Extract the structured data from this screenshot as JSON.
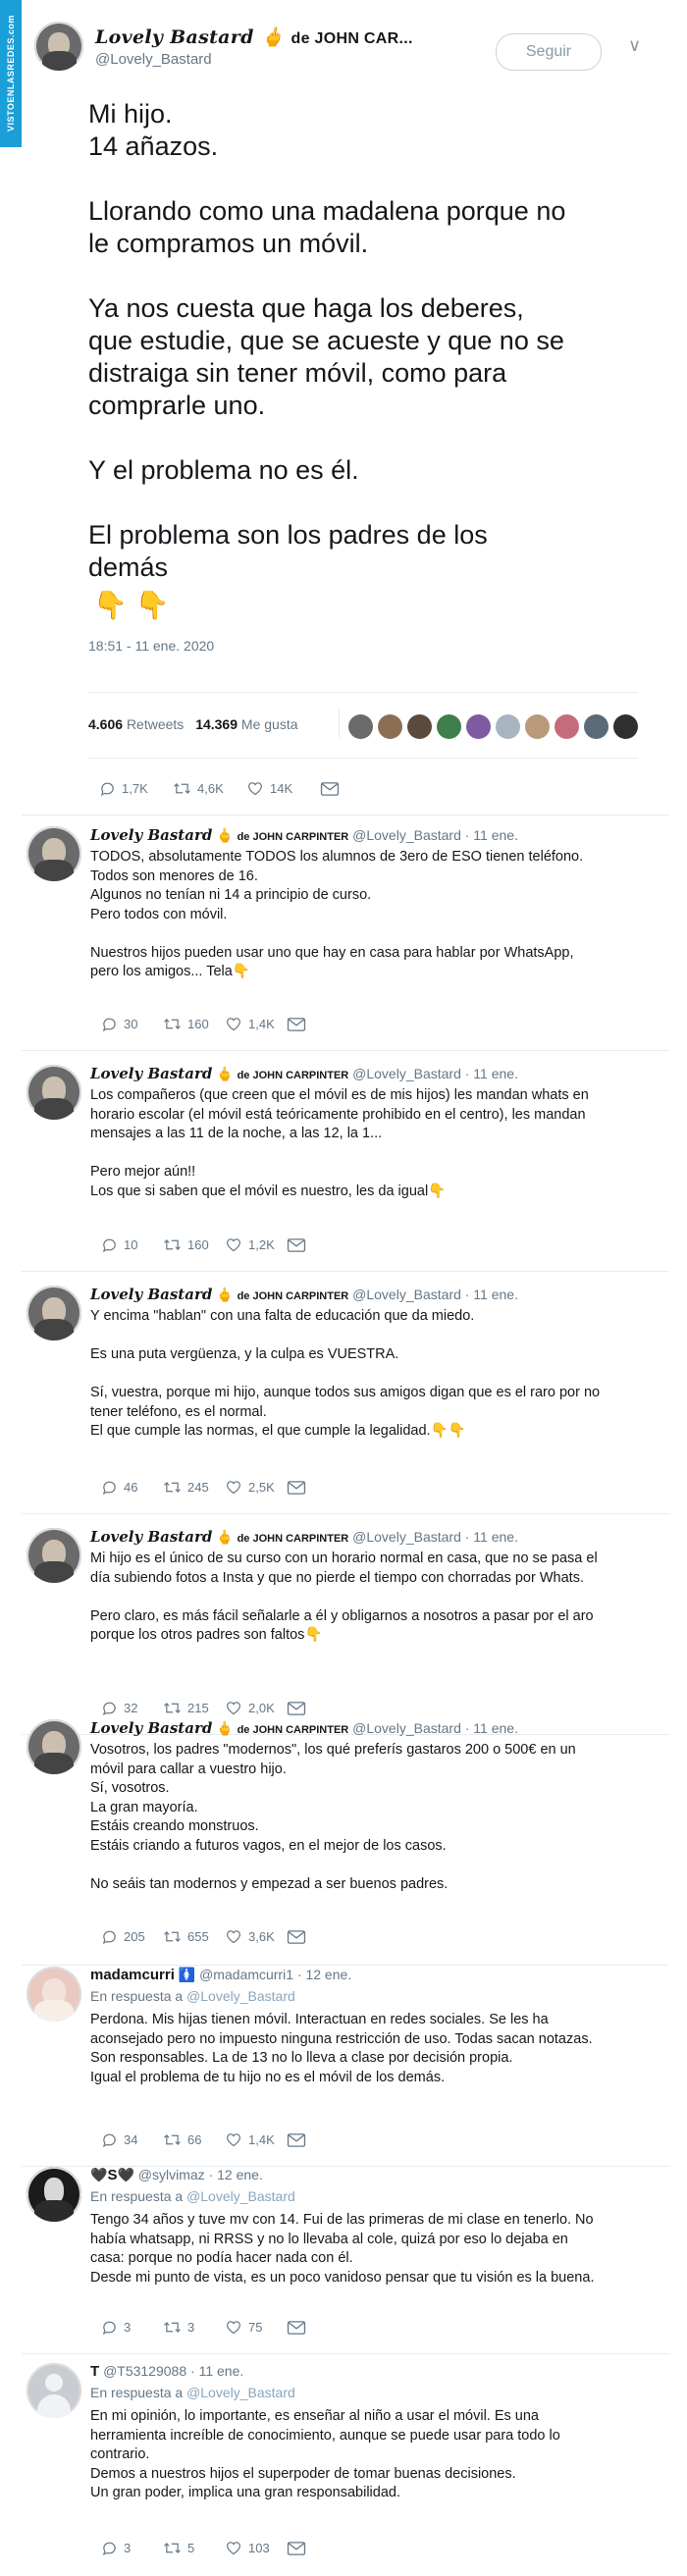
{
  "banner": "VISTOENLASREDES.com",
  "header": {
    "name": "Lovely Bastard",
    "name_rest": "de JOHN CAR...",
    "handle": "@Lovely_Bastard",
    "follow_label": "Seguir",
    "chevron": "∨"
  },
  "tweet": {
    "text": "Mi hijo.\n14 añazos.\n\nLlorando como una madalena porque no\nle compramos un móvil.\n\nYa nos cuesta que haga los deberes,\nque estudie, que se acueste y que no se\ndistraiga sin tener móvil, como para\ncomprarle uno.\n\nY el problema no es él.\n\nEl problema son los padres de los\ndemás",
    "emoji": "👇",
    "time": "18:51 - 11 ene. 2020",
    "retweets": "4.606",
    "retweets_label": "Retweets",
    "likes": "14.369",
    "likes_label": "Me gusta",
    "mini_avatar_colors": [
      "#6b6b6b",
      "#8a6f55",
      "#5c4a3c",
      "#3f7f4b",
      "#7e5aa2",
      "#a8b4c2",
      "#b89a7a",
      "#c56b7b",
      "#5b6a78",
      "#2f2f2f"
    ],
    "actions": {
      "replies": "1,7K",
      "retweets": "4,6K",
      "likes": "14K"
    }
  },
  "replies": [
    {
      "name": "Lovely Bastard",
      "name2": "de JOHN CARPINTER",
      "handle": "@Lovely_Bastard",
      "date": "· 11 ene.",
      "text": "TODOS, absolutamente TODOS los alumnos de 3ero de ESO tienen teléfono.\nTodos son menores de 16.\nAlgunos no tenían ni 14 a principio de curso.\nPero todos con móvil.\n\nNuestros hijos pueden usar uno que hay en casa para hablar por WhatsApp,\npero los amigos... Tela",
      "emoji": "👇",
      "replies": "30",
      "retweets": "160",
      "likes": "1,4K"
    },
    {
      "name": "Lovely Bastard",
      "name2": "de JOHN CARPINTER",
      "handle": "@Lovely_Bastard",
      "date": "· 11 ene.",
      "text": "Los compañeros (que creen que el móvil es de mis hijos) les mandan whats en\nhorario escolar (el móvil está teóricamente prohibido en el centro), les mandan\nmensajes a las 11 de la noche, a las 12, la 1...\n\nPero mejor aún!!\nLos que si saben que el móvil es nuestro, les da igual",
      "emoji": "👇",
      "replies": "10",
      "retweets": "160",
      "likes": "1,2K"
    },
    {
      "name": "Lovely Bastard",
      "name2": "de JOHN CARPINTER",
      "handle": "@Lovely_Bastard",
      "date": "· 11 ene.",
      "text": "Y encima \"hablan\" con una falta de educación que da miedo.\n\nEs una puta vergüenza, y la culpa es VUESTRA.\n\nSí, vuestra, porque mi hijo, aunque todos sus amigos digan que es el raro por no\ntener teléfono, es el normal.\nEl que cumple las normas, el que cumple la legalidad.",
      "emoji": "👇👇",
      "replies": "46",
      "retweets": "245",
      "likes": "2,5K"
    },
    {
      "name": "Lovely Bastard",
      "name2": "de JOHN CARPINTER",
      "handle": "@Lovely_Bastard",
      "date": "· 11 ene.",
      "text": "Mi hijo es el único de su curso con un horario normal en casa, que no se pasa el\ndía subiendo fotos a Insta y que no pierde el tiempo con chorradas por Whats.\n\nPero claro, es más fácil señalarle a él y obligarnos a nosotros a pasar por el aro\nporque los otros padres son faltos",
      "emoji": "👇",
      "replies": "32",
      "retweets": "215",
      "likes": "2,0K"
    },
    {
      "name": "Lovely Bastard",
      "name2": "de JOHN CARPINTER",
      "handle": "@Lovely_Bastard",
      "date": "· 11 ene.",
      "text": "Vosotros, los padres \"modernos\", los qué preferís gastaros 200 o 500€ en un\nmóvil para callar a vuestro hijo.\nSí, vosotros.\nLa gran mayoría.\nEstáis creando monstruos.\nEstáis criando a futuros vagos, en el mejor de los casos.\n\nNo seáis tan modernos y empezad a ser buenos padres.",
      "emoji": "",
      "replies": "205",
      "retweets": "655",
      "likes": "3,6K"
    },
    {
      "name": "madamcurri",
      "name_emoji": "🚺",
      "handle": "@madamcurri1",
      "date": "· 12 ene.",
      "response_label": "En respuesta a",
      "response_to": "@Lovely_Bastard",
      "text": "Perdona. Mis hijas tienen móvil. Interactuan en redes sociales. Se les ha\naconsejado pero no impuesto ninguna restricción de uso. Todas sacan notazas.\nSon responsables. La de 13 no lo lleva a clase por decisión propia.\nIgual el problema de tu hijo no es el móvil de los demás.",
      "emoji": "",
      "replies": "34",
      "retweets": "66",
      "likes": "1,4K"
    },
    {
      "name": "S",
      "name_pre": "🖤",
      "name_post": "🖤",
      "handle": "@sylvimaz",
      "date": "· 12 ene.",
      "response_label": "En respuesta a",
      "response_to": "@Lovely_Bastard",
      "text": "Tengo 34 años y tuve mv con 14. Fui de las primeras de mi clase en tenerlo. No\nhabía whatsapp, ni RRSS y no lo llevaba al cole, quizá por eso lo dejaba en\ncasa: porque no podía hacer nada con él.\nDesde mi punto de vista, es un poco vanidoso pensar que tu visión es la buena.",
      "emoji": "",
      "replies": "3",
      "retweets": "3",
      "likes": "75"
    },
    {
      "name": "T",
      "handle": "@T53129088",
      "date": "· 11 ene.",
      "response_label": "En respuesta a",
      "response_to": "@Lovely_Bastard",
      "text": "En mi opinión, lo importante, es enseñar al niño a usar el móvil. Es una\nherramienta increíble de conocimiento, aunque se puede usar para todo lo\ncontrario.\nDemos a nuestros hijos el superpoder de tomar buenas decisiones.\nUn gran poder, implica una gran responsabilidad.",
      "emoji": "",
      "replies": "3",
      "retweets": "5",
      "likes": "103"
    }
  ]
}
